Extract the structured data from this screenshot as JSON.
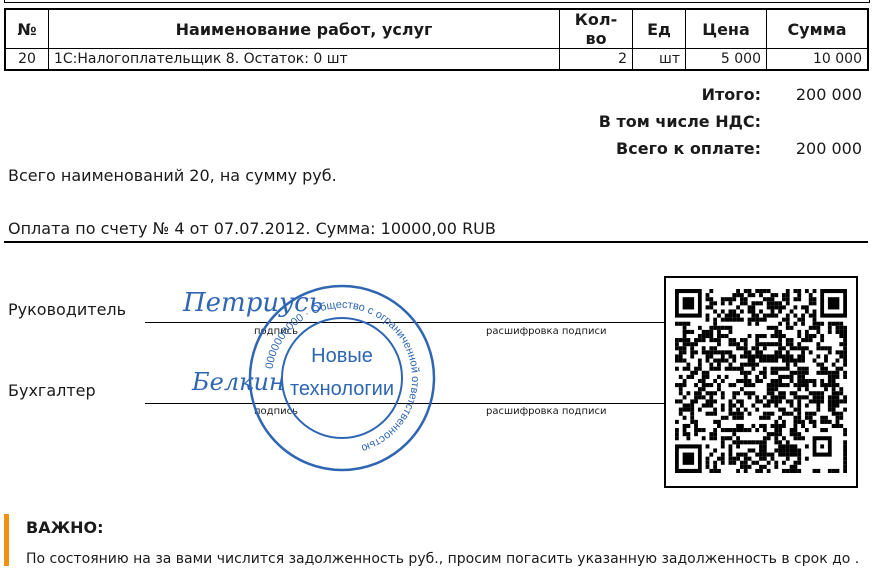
{
  "table": {
    "headers": {
      "num": "№",
      "name": "Наименование работ, услуг",
      "qty": "Кол-во",
      "unit": "Ед",
      "price": "Цена",
      "sum": "Сумма"
    },
    "rows": [
      {
        "num": "20",
        "name": "1С:Налогоплательщик 8. Остаток: 0 шт",
        "qty": "2",
        "unit": "шт",
        "price": "5 000",
        "sum": "10 000"
      }
    ]
  },
  "totals": {
    "total_label": "Итого:",
    "total_value": "200 000",
    "vat_label": "В том числе НДС:",
    "vat_value": "",
    "pay_label": "Всего к оплате:",
    "pay_value": "200 000"
  },
  "summary_line": "Всего наименований 20, на сумму  руб.",
  "payment_line": "Оплата по счету № 4 от 07.07.2012. Сумма: 10000,00 RUB",
  "signatures": {
    "director_label": "Руководитель",
    "accountant_label": "Бухгалтер",
    "sign_caption": "подпись",
    "decode_caption": "расшифровка подписи",
    "director_signature": "Петриусь",
    "accountant_signature": "Белкин"
  },
  "stamp": {
    "center_line1": "Новые",
    "center_line2": "технологии",
    "ring_text": "Общество с ограниченной ответственностью",
    "ring_number": "0000000000",
    "color": "#2f66b3"
  },
  "warning": {
    "title": "ВАЖНО:",
    "text": "По состоянию на  за вами числится задолженность  руб., просим погасить указанную задолженность в срок до .",
    "accent_color": "#f29111"
  }
}
